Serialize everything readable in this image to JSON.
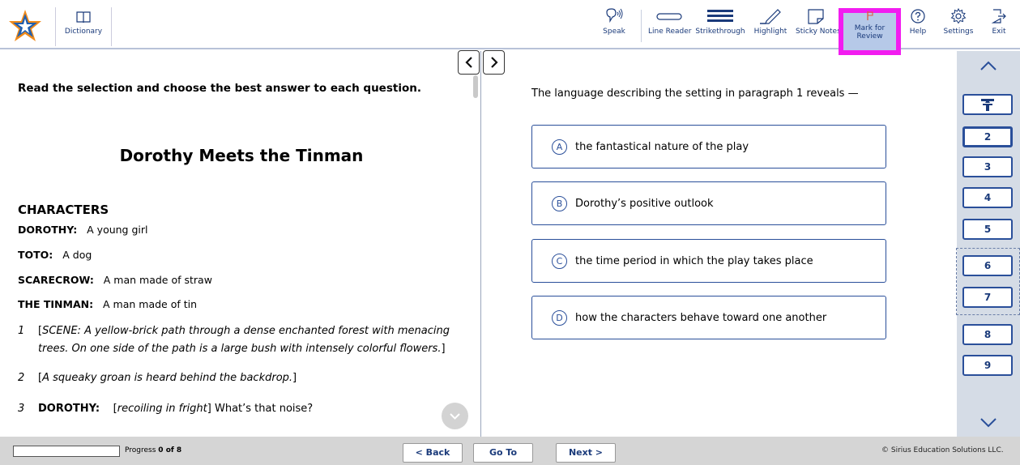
{
  "toolbar": {
    "dictionary_label": "Dictionary",
    "speak_label": "Speak",
    "line_reader_label": "Line Reader",
    "strikethrough_label": "Strikethrough",
    "highlight_label": "Highlight",
    "sticky_notes_label": "Sticky Notes",
    "mark_line1": "Mark for",
    "mark_line2": "Review",
    "help_label": "Help",
    "settings_label": "Settings",
    "exit_label": "Exit"
  },
  "passage": {
    "instruction": "Read the selection and choose the best answer to each question.",
    "title": "Dorothy Meets the Tinman",
    "characters_heading": "CHARACTERS",
    "characters": [
      {
        "name": "DOROTHY:",
        "desc": "A young girl"
      },
      {
        "name": "TOTO:",
        "desc": "A dog"
      },
      {
        "name": "SCARECROW:",
        "desc": "A man made of straw"
      },
      {
        "name": "THE TINMAN:",
        "desc": "A man made of tin"
      }
    ],
    "paragraphs": [
      {
        "num": "1",
        "open": "[",
        "text": "SCENE: A yellow-brick path through a dense enchanted forest with menacing trees. On one side of the path is a large bush with intensely colorful flowers.",
        "close": "]"
      },
      {
        "num": "2",
        "open": "[",
        "text": "A squeaky groan is heard behind the backdrop.",
        "close": "]"
      },
      {
        "num": "3",
        "speaker": "DOROTHY:",
        "open": "[",
        "stage": "recoiling in fright",
        "close": "]",
        "text": "What’s that noise?"
      }
    ]
  },
  "question": {
    "prompt": "The language describing the setting in paragraph 1 reveals —",
    "choices": [
      {
        "letter": "A",
        "text": "the fantastical nature of the play"
      },
      {
        "letter": "B",
        "text": "Dorothy’s positive outlook"
      },
      {
        "letter": "C",
        "text": "the time period in which the play takes place"
      },
      {
        "letter": "D",
        "text": "how the characters behave toward one another"
      }
    ]
  },
  "sidebar": {
    "questions": [
      "2",
      "3",
      "4",
      "5",
      "6",
      "7",
      "8",
      "9"
    ],
    "current": "2"
  },
  "footer": {
    "progress_prefix": "Progress",
    "progress_value": "0 of 8",
    "progress_fraction": 0,
    "back_label": "< Back",
    "goto_label": "Go To",
    "next_label": "Next >",
    "copyright": "© Sirius Education Solutions LLC."
  },
  "colors": {
    "accent": "#1a3a7a",
    "highlight_border": "#f21cf0",
    "mark_bg": "#b6c9e8",
    "sidebar_bg": "#d5dce6"
  }
}
